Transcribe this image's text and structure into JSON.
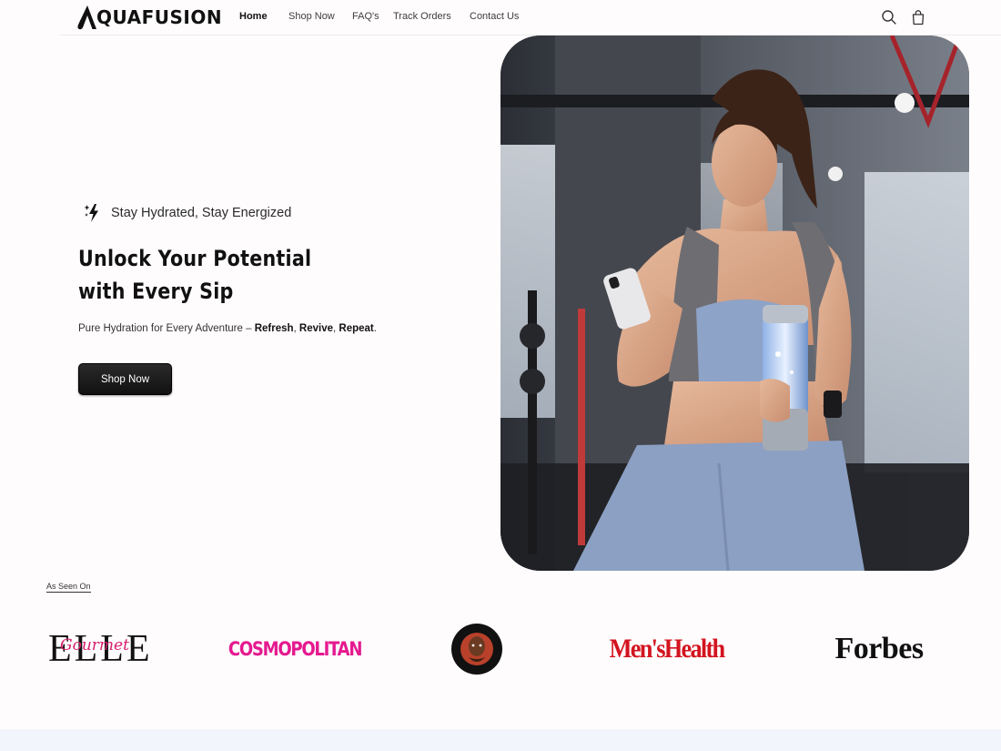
{
  "header": {
    "logo_text": "QUAFUSION",
    "logo_icon": "droplet-a-icon",
    "nav": [
      "Home",
      "Shop Now",
      "FAQ's",
      "Track Orders",
      "Contact Us"
    ],
    "active_nav": "Home",
    "icons": [
      "search-icon",
      "shopping-bag-icon"
    ]
  },
  "hero": {
    "tagline_icon": "lightning-sparkle-icon",
    "tagline": "Stay Hydrated, Stay Energized",
    "headline": "Unlock Your Potential with Every Sip",
    "sub_prefix": "Pure Hydration for Every Adventure – ",
    "sub_word1": "Refresh",
    "sub_sep1": ", ",
    "sub_word2": "Revive",
    "sub_sep2": ", ",
    "sub_word3": "Repeat",
    "sub_end": ".",
    "cta_label": "Shop Now"
  },
  "press": {
    "title": "As Seen On",
    "logos": {
      "elle": "ELLE",
      "gourmet": "Gourmet",
      "cosmo": "COSMOPOLITAN",
      "joe": "THE JOE ROGAN EXPERIENCE",
      "menshealth": "Men'sHealth",
      "forbes": "Forbes"
    }
  },
  "colors": {
    "background": "#fffcfd",
    "button": "#161616",
    "cosmo": "#e5198f",
    "menshealth": "#d3141f",
    "gourmet": "#d6206e",
    "footer_band": "#f2f5fb"
  }
}
